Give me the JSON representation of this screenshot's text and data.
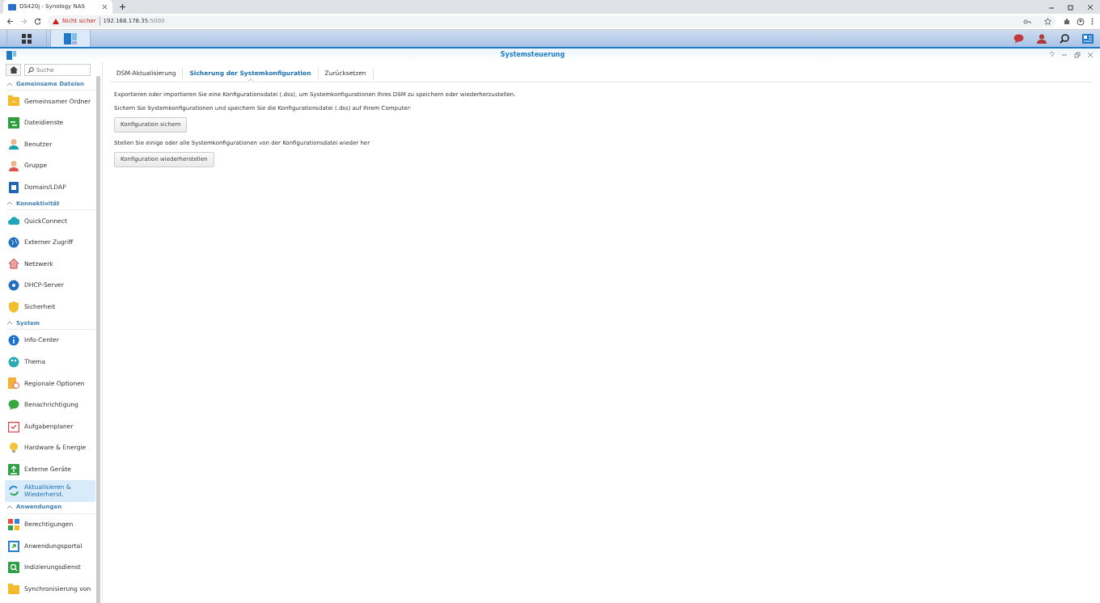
{
  "browser": {
    "tab_title": "DS420j - Synology NAS",
    "warning": "Nicht sicher",
    "host": "192.168.178.35",
    "port": ":5000"
  },
  "window": {
    "title": "Systemsteuerung"
  },
  "sidebar": {
    "search": {
      "placeholder": "Suche"
    },
    "groups": [
      {
        "title": "Gemeinsame Dateien",
        "expanded": true,
        "items": [
          {
            "label": "Gemeinsamer Ordner",
            "selected": false
          },
          {
            "label": "Dateidienste",
            "selected": false
          },
          {
            "label": "Benutzer",
            "selected": false
          },
          {
            "label": "Gruppe",
            "selected": false
          },
          {
            "label": "Domain/LDAP",
            "selected": false
          }
        ]
      },
      {
        "title": "Konnektivität",
        "expanded": true,
        "items": [
          {
            "label": "QuickConnect",
            "selected": false
          },
          {
            "label": "Externer Zugriff",
            "selected": false
          },
          {
            "label": "Netzwerk",
            "selected": false
          },
          {
            "label": "DHCP-Server",
            "selected": false
          },
          {
            "label": "Sicherheit",
            "selected": false
          }
        ]
      },
      {
        "title": "System",
        "expanded": true,
        "items": [
          {
            "label": "Info-Center",
            "selected": false
          },
          {
            "label": "Thema",
            "selected": false
          },
          {
            "label": "Regionale Optionen",
            "selected": false
          },
          {
            "label": "Benachrichtigung",
            "selected": false
          },
          {
            "label": "Aufgabenplaner",
            "selected": false
          },
          {
            "label": "Hardware & Energie",
            "selected": false
          },
          {
            "label": "Externe Geräte",
            "selected": false
          },
          {
            "label": "Aktualisieren & Wiederherst.",
            "selected": true
          }
        ]
      },
      {
        "title": "Anwendungen",
        "expanded": true,
        "items": [
          {
            "label": "Berechtigungen",
            "selected": false
          },
          {
            "label": "Anwendungsportal",
            "selected": false
          },
          {
            "label": "Indizierungsdienst",
            "selected": false
          },
          {
            "label": "Synchronisierung von",
            "selected": false
          }
        ]
      }
    ]
  },
  "tabs": [
    {
      "label": "DSM-Aktualisierung",
      "selected": false
    },
    {
      "label": "Sicherung der Systemkonfiguration",
      "selected": true
    },
    {
      "label": "Zurücksetzen",
      "selected": false
    }
  ],
  "content": [
    {
      "kind": "text",
      "text": "Exportieren oder importieren Sie eine Konfigurationsdatei (.dss), um Systemkonfigurationen Ihres DSM zu speichern oder wiederherzustellen."
    },
    {
      "kind": "text",
      "text": "Sichern Sie Systemkonfigurationen und speichern Sie die Konfigurationsdatei (.dss) auf Ihrem Computer:"
    },
    {
      "kind": "button",
      "text": "Konfiguration sichern"
    },
    {
      "kind": "text",
      "text": "Stellen Sie einige oder alle Systemkonfigurationen von der Konfigurationsdatei wieder her"
    },
    {
      "kind": "button",
      "text": "Konfiguration wiederherstellen"
    }
  ]
}
